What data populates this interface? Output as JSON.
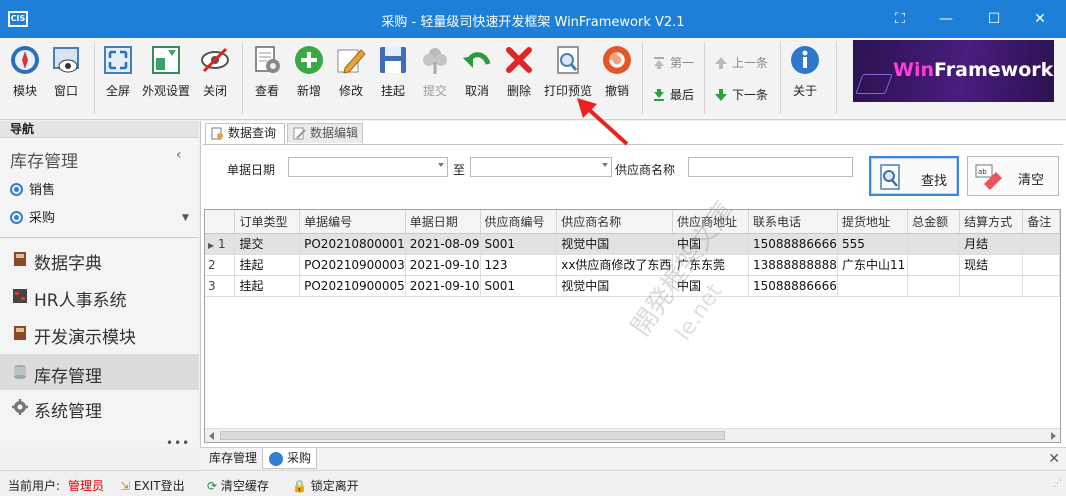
{
  "window": {
    "logo": "CIS",
    "title": "采购 - 轻量级司快速开发框架 WinFramework V2.1"
  },
  "toolbar": {
    "module": "模块",
    "window": "窗口",
    "fullscreen": "全屏",
    "appearance": "外观设置",
    "close": "关闭",
    "view": "查看",
    "add": "新增",
    "edit": "修改",
    "suspend": "挂起",
    "submit": "提交",
    "cancel": "取消",
    "delete": "删除",
    "print_preview": "打印预览",
    "revoke": "撤销",
    "first": "第一",
    "last": "最后",
    "prev": "上一条",
    "next": "下一条",
    "about": "关于",
    "banner": {
      "prefix": "Win",
      "suffix": "Framework"
    }
  },
  "sidebar": {
    "header": "导航",
    "current_group": "库存管理",
    "sub_items": [
      "销售",
      "采购"
    ],
    "groups": [
      "数据字典",
      "HR人事系统",
      "开发演示模块",
      "库存管理",
      "系统管理"
    ],
    "more": "•••"
  },
  "tabs": [
    "数据查询",
    "数据编辑"
  ],
  "filter": {
    "date_label": "单据日期",
    "to_label": "至",
    "supplier_label": "供应商名称",
    "date_from": "",
    "date_to": "",
    "supplier": "",
    "search_button": "查找",
    "clear_button": "清空"
  },
  "grid": {
    "columns": [
      "订单类型",
      "单据编号",
      "单据日期",
      "供应商编号",
      "供应商名称",
      "供应商地址",
      "联系电话",
      "提货地址",
      "总金额",
      "结算方式",
      "备注"
    ],
    "rows": [
      {
        "no": "1",
        "cells": [
          "提交",
          "PO20210800001",
          "2021-08-09",
          "S001",
          "视觉中国",
          "中国",
          "15088886666",
          "555",
          "",
          "月结",
          ""
        ]
      },
      {
        "no": "2",
        "cells": [
          "挂起",
          "PO20210900003",
          "2021-09-10",
          "123",
          "xx供应商修改了东西",
          "广东东莞",
          "13888888888",
          "广东中山11",
          "",
          "现结",
          ""
        ]
      },
      {
        "no": "3",
        "cells": [
          "挂起",
          "PO20210900005",
          "2021-09-10",
          "S001",
          "视觉中国",
          "中国",
          "15088886666",
          "",
          "",
          "",
          ""
        ]
      }
    ]
  },
  "doc_tabs": [
    "库存管理",
    "采购"
  ],
  "status": {
    "user_label": "当前用户:",
    "user_name": "管理员",
    "logout": "EXIT登出",
    "clear_cache": "清空缓存",
    "lock": "锁定离开"
  },
  "watermark": {
    "line1": "開発框架文庫",
    "line2": "le.net"
  }
}
